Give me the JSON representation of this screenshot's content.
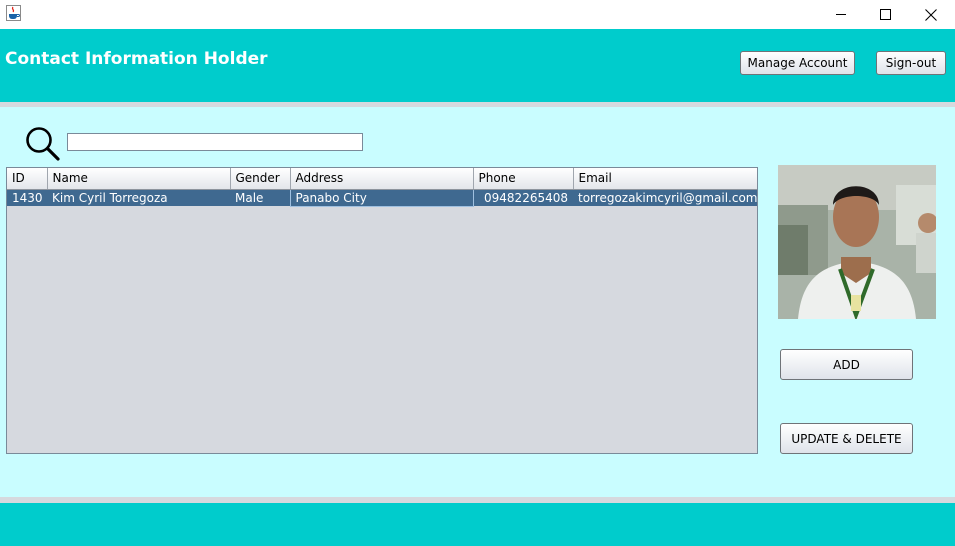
{
  "window": {
    "app_icon": "java-coffee-cup-icon",
    "controls": [
      "minimize-icon",
      "maximize-icon",
      "close-icon"
    ]
  },
  "header": {
    "title": "Contact Information Holder",
    "manage_account_label": "Manage Account",
    "signout_label": "Sign-out"
  },
  "search": {
    "value": "",
    "placeholder": ""
  },
  "table": {
    "columns": [
      "ID",
      "Name",
      "Gender",
      "Address",
      "Phone",
      "Email"
    ],
    "rows": [
      {
        "id": "1430",
        "name": "Kim Cyril Torregoza",
        "gender": "Male",
        "address": "Panabo City",
        "phone": "09482265408",
        "email": "torregozakimcyril@gmail.com"
      }
    ]
  },
  "actions": {
    "add_label": "ADD",
    "update_delete_label": "UPDATE & DELETE"
  },
  "colors": {
    "header_bg": "#00cccc",
    "content_bg": "#c9fdff",
    "selected_row": "#3f6990",
    "table_bg": "#d6d9df"
  }
}
